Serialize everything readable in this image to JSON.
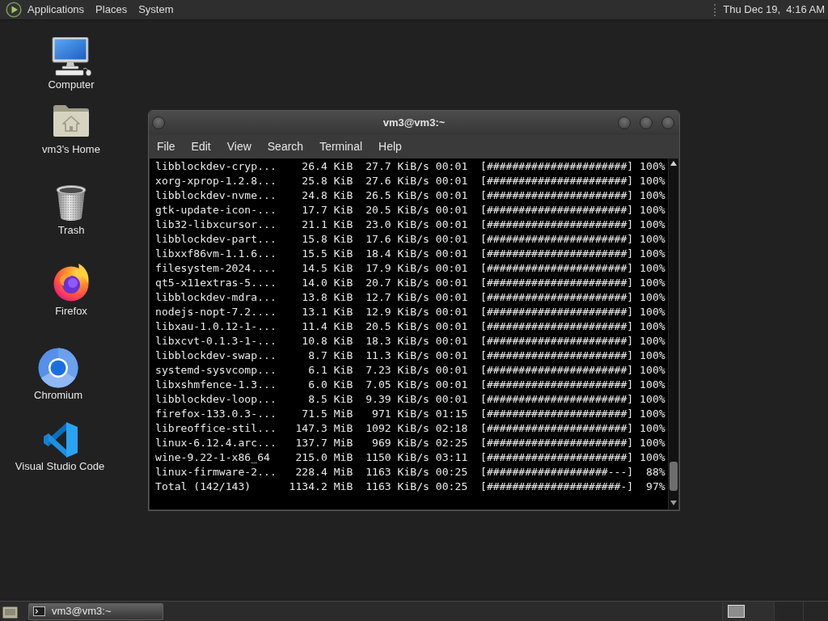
{
  "top_panel": {
    "menus": [
      "Applications",
      "Places",
      "System"
    ],
    "clock": "Thu Dec 19,  4:16 AM"
  },
  "desktop_icons": [
    {
      "kind": "computer",
      "label": "Computer"
    },
    {
      "kind": "home",
      "label": "vm3's Home"
    },
    {
      "kind": "trash",
      "label": "Trash"
    },
    {
      "kind": "firefox",
      "label": "Firefox"
    },
    {
      "kind": "chromium",
      "label": "Chromium"
    },
    {
      "kind": "vscode",
      "label": "Visual Studio Code"
    }
  ],
  "terminal_window": {
    "title": "vm3@vm3:~",
    "menus": [
      "File",
      "Edit",
      "View",
      "Search",
      "Terminal",
      "Help"
    ],
    "lines": [
      "libblockdev-cryp...    26.4 KiB  27.7 KiB/s 00:01  [######################] 100%",
      "xorg-xprop-1.2.8...    25.8 KiB  27.6 KiB/s 00:01  [######################] 100%",
      "libblockdev-nvme...    24.8 KiB  26.5 KiB/s 00:01  [######################] 100%",
      "gtk-update-icon-...    17.7 KiB  20.5 KiB/s 00:01  [######################] 100%",
      "lib32-libxcursor...    21.1 KiB  23.0 KiB/s 00:01  [######################] 100%",
      "libblockdev-part...    15.8 KiB  17.6 KiB/s 00:01  [######################] 100%",
      "libxxf86vm-1.1.6...    15.5 KiB  18.4 KiB/s 00:01  [######################] 100%",
      "filesystem-2024....    14.5 KiB  17.9 KiB/s 00:01  [######################] 100%",
      "qt5-x11extras-5....    14.0 KiB  20.7 KiB/s 00:01  [######################] 100%",
      "libblockdev-mdra...    13.8 KiB  12.7 KiB/s 00:01  [######################] 100%",
      "nodejs-nopt-7.2....    13.1 KiB  12.9 KiB/s 00:01  [######################] 100%",
      "libxau-1.0.12-1-...    11.4 KiB  20.5 KiB/s 00:01  [######################] 100%",
      "libxcvt-0.1.3-1-...    10.8 KiB  18.3 KiB/s 00:01  [######################] 100%",
      "libblockdev-swap...     8.7 KiB  11.3 KiB/s 00:01  [######################] 100%",
      "systemd-sysvcomp...     6.1 KiB  7.23 KiB/s 00:01  [######################] 100%",
      "libxshmfence-1.3...     6.0 KiB  7.05 KiB/s 00:01  [######################] 100%",
      "libblockdev-loop...     8.5 KiB  9.39 KiB/s 00:01  [######################] 100%",
      "firefox-133.0.3-...    71.5 MiB   971 KiB/s 01:15  [######################] 100%",
      "libreoffice-stil...   147.3 MiB  1092 KiB/s 02:18  [######################] 100%",
      "linux-6.12.4.arc...   137.7 MiB   969 KiB/s 02:25  [######################] 100%",
      "wine-9.22-1-x86_64    215.0 MiB  1150 KiB/s 03:11  [######################] 100%",
      "linux-firmware-2...   228.4 MiB  1163 KiB/s 00:25  [###################---]  88%",
      "Total (142/143)      1134.2 MiB  1163 KiB/s 00:25  [#####################-]  97%"
    ]
  },
  "taskbar": {
    "tasks": [
      {
        "label": "vm3@vm3:~"
      }
    ]
  }
}
